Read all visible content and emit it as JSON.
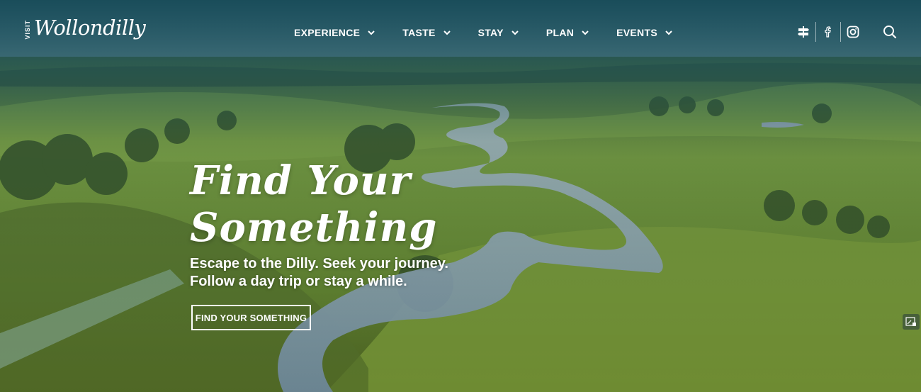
{
  "brand": {
    "visit": "VISIT",
    "name": "Wollondilly"
  },
  "nav": [
    {
      "label": "EXPERIENCE"
    },
    {
      "label": "TASTE"
    },
    {
      "label": "STAY"
    },
    {
      "label": "PLAN"
    },
    {
      "label": "EVENTS"
    }
  ],
  "utilities": [
    "map-signpost-icon",
    "facebook-icon",
    "instagram-icon",
    "search-icon"
  ],
  "hero": {
    "headline_line1": "Find Your",
    "headline_line2": "Something",
    "sub_line1": "Escape to the Dilly. Seek your journey.",
    "sub_line2": "Follow a day trip or stay a while.",
    "cta_label": "FIND YOUR SOMETHING"
  },
  "colors": {
    "header_overlay": "#1d5866",
    "text": "#ffffff",
    "grass": "#7fa83a",
    "river": "#9fb6c8"
  }
}
